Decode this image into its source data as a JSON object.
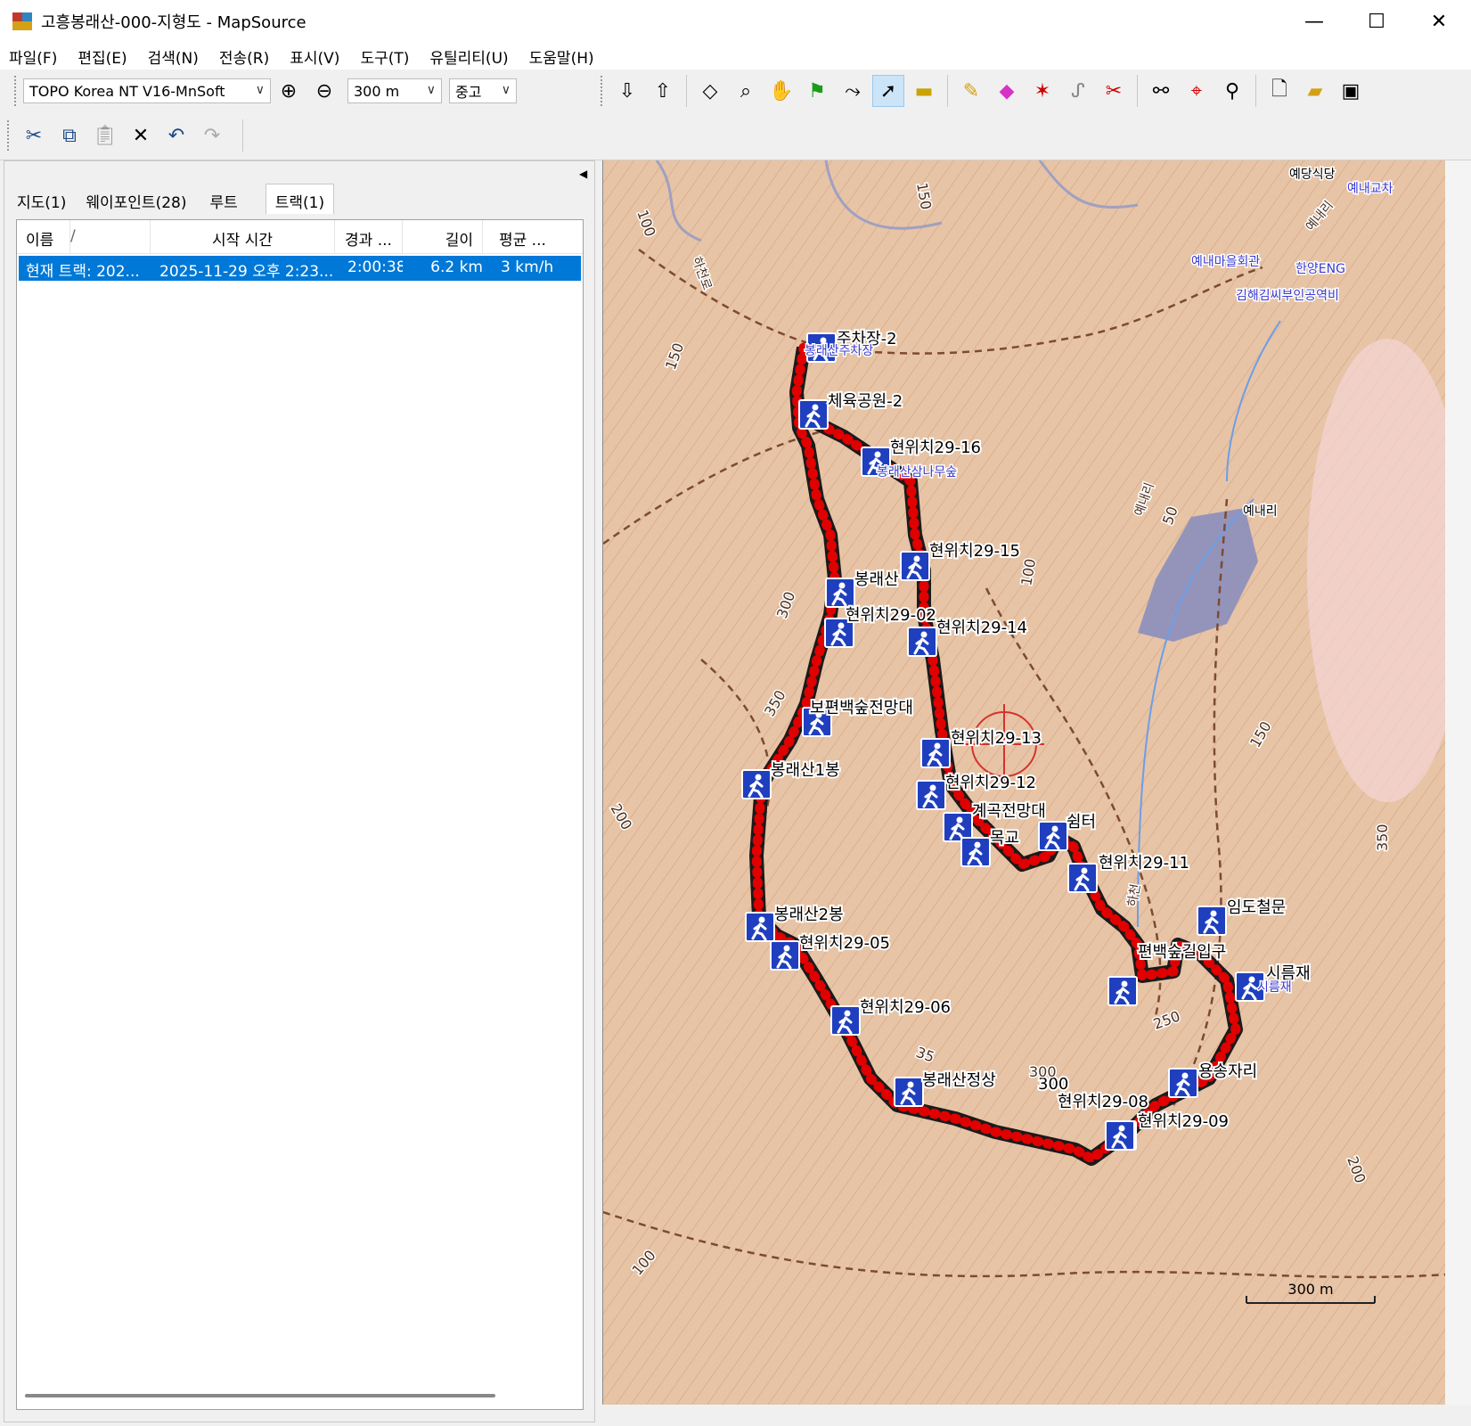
{
  "window": {
    "title": "고흥봉래산-000-지형도 - MapSource",
    "minimize": "—",
    "maximize": "☐",
    "close": "✕"
  },
  "menu": [
    "파일(F)",
    "편집(E)",
    "검색(N)",
    "전송(R)",
    "표시(V)",
    "도구(T)",
    "유틸리티(U)",
    "도움말(H)"
  ],
  "toolbar": {
    "map_product": "TOPO Korea NT V16-MnSoft",
    "zoom_scale": "300 m",
    "detail": "중고"
  },
  "tabs": [
    "지도(1)",
    "웨이포인트(28)",
    "루트",
    "트랙(1)"
  ],
  "active_tab": "트랙(1)",
  "track_table": {
    "columns": [
      "이름",
      "/",
      "시작 시간",
      "경과 ...",
      "길이",
      "평균 ..."
    ],
    "rows": [
      {
        "name": "현재 트랙: 202...",
        "start": "2025-11-29 오후 2:23...",
        "elapsed": "2:00:38",
        "length": "6.2 km",
        "avg": "3 km/h"
      }
    ]
  },
  "map": {
    "scale_label": "300 m",
    "track_color": "#e00000",
    "contour_labels": [
      "100",
      "150",
      "150",
      "300",
      "350",
      "200",
      "50",
      "100",
      "150",
      "350",
      "250",
      "300",
      "200",
      "100",
      "35"
    ],
    "road_labels": [
      "하천로",
      "예내리",
      "예내리",
      "하천"
    ],
    "poi_labels": [
      "예당식당",
      "예내교차",
      "예내마을회관",
      "한양ENG",
      "김해김씨부인공역비",
      "예내리",
      "봉래산주차장",
      "봉래산삼나무숲",
      "시름재"
    ],
    "waypoints": [
      {
        "label": "주차장-2"
      },
      {
        "label": "체육공원-2"
      },
      {
        "label": "현위치29-16"
      },
      {
        "label": "현위치29-15"
      },
      {
        "label": "봉래산"
      },
      {
        "label": "현위치29-02"
      },
      {
        "label": "현위치29-14"
      },
      {
        "label": "보편백숲전망대"
      },
      {
        "label": "현위치29-13"
      },
      {
        "label": "봉래산1봉"
      },
      {
        "label": "현위치29-12"
      },
      {
        "label": "계곡전망대"
      },
      {
        "label": "쉼터"
      },
      {
        "label": "목교"
      },
      {
        "label": "현위치29-11"
      },
      {
        "label": "임도철문"
      },
      {
        "label": "봉래산2봉"
      },
      {
        "label": "현위치29-05"
      },
      {
        "label": "편백숲길입구"
      },
      {
        "label": "시름재"
      },
      {
        "label": "현위치29-06"
      },
      {
        "label": "봉래산정상"
      },
      {
        "label": "용송자리"
      },
      {
        "label": "300"
      },
      {
        "label": "현위치29-08"
      },
      {
        "label": "현위치29-09"
      }
    ]
  }
}
